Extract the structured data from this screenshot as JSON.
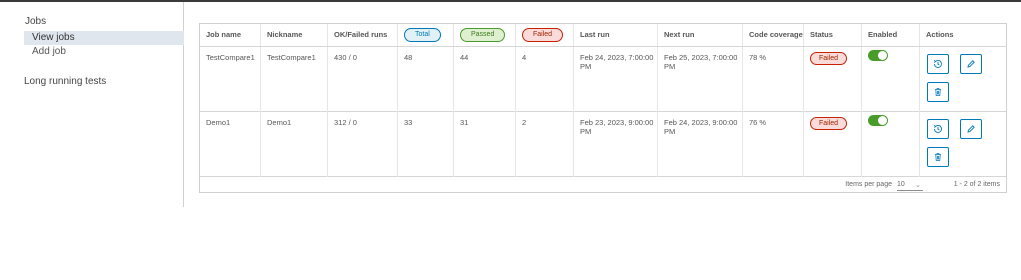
{
  "sidebar": {
    "group_label": "Jobs",
    "items": [
      {
        "label": "View jobs",
        "active": true
      },
      {
        "label": "Add job",
        "active": false
      }
    ],
    "long_running_label": "Long running tests"
  },
  "table": {
    "headers": {
      "job_name": "Job name",
      "nickname": "Nickname",
      "ok_failed": "OK/Failed runs",
      "total": "Total",
      "passed": "Passed",
      "failed": "Failed",
      "last_run": "Last run",
      "next_run": "Next run",
      "coverage": "Code coverage",
      "status": "Status",
      "enabled": "Enabled",
      "actions": "Actions"
    },
    "rows": [
      {
        "job_name": "TestCompare1",
        "nickname": "TestCompare1",
        "ok_failed": "430 / 0",
        "total": "48",
        "passed": "44",
        "failed": "4",
        "last_run": "Feb 24, 2023, 7:00:00 PM",
        "next_run": "Feb 25, 2023, 7:00:00 PM",
        "coverage": "78 %",
        "status": "Failed",
        "enabled": true
      },
      {
        "job_name": "Demo1",
        "nickname": "Demo1",
        "ok_failed": "312 / 0",
        "total": "33",
        "passed": "31",
        "failed": "2",
        "last_run": "Feb 23, 2023, 9:00:00 PM",
        "next_run": "Feb 24, 2023, 9:00:00 PM",
        "coverage": "76 %",
        "status": "Failed",
        "enabled": true
      }
    ],
    "footer": {
      "items_per_page_label": "Items per page",
      "items_per_page_value": "10",
      "range_text": "1 - 2 of 2 items"
    }
  },
  "icons": {
    "history": "history-icon",
    "edit": "pencil-icon",
    "delete": "trash-icon",
    "dropdown": "chevron-down-icon"
  },
  "colors": {
    "accent": "#0079b8",
    "success": "#489d2a",
    "danger": "#c92100",
    "active_nav_bg": "#dfe6ee"
  }
}
